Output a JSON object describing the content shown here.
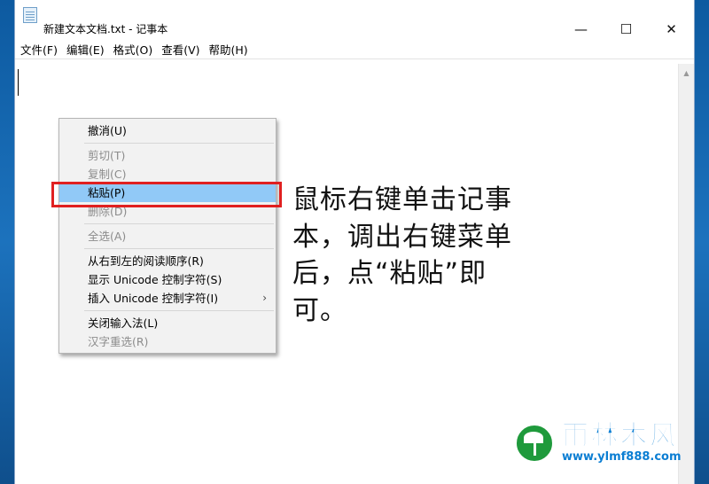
{
  "window": {
    "title": "新建文本文档.txt - 记事本"
  },
  "titlebar_buttons": {
    "minimize": "—",
    "maximize": "☐",
    "close": "✕"
  },
  "menubar": {
    "items": [
      "文件(F)",
      "编辑(E)",
      "格式(O)",
      "查看(V)",
      "帮助(H)"
    ]
  },
  "context_menu": {
    "items": [
      {
        "label": "撤消(U)",
        "enabled": true
      },
      {
        "label": "剪切(T)",
        "enabled": false
      },
      {
        "label": "复制(C)",
        "enabled": false
      },
      {
        "label": "粘贴(P)",
        "enabled": true,
        "highlighted": true
      },
      {
        "label": "删除(D)",
        "enabled": false
      },
      {
        "label": "全选(A)",
        "enabled": false
      },
      {
        "label": "从右到左的阅读顺序(R)",
        "enabled": true
      },
      {
        "label": "显示 Unicode 控制字符(S)",
        "enabled": true
      },
      {
        "label": "插入 Unicode 控制字符(I)",
        "enabled": true,
        "submenu": true
      },
      {
        "label": "关闭输入法(L)",
        "enabled": true
      },
      {
        "label": "汉字重选(R)",
        "enabled": false
      }
    ],
    "submenu_arrow": "›"
  },
  "instruction": {
    "text": "鼠标右键单击记事本，调出右键菜单后，点“粘贴”即可。"
  },
  "watermark": {
    "name": "雨林木风",
    "url": "www.ylmf888.com"
  },
  "colors": {
    "highlight": "#91c9f7",
    "annotation_box": "#e02020",
    "watermark_blue": "#0b7ed3"
  }
}
